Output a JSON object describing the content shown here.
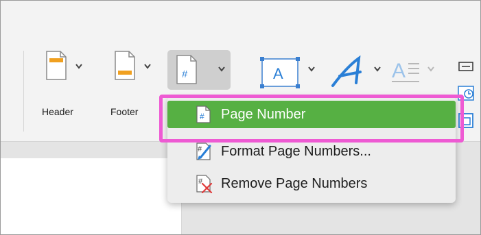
{
  "ribbon": {
    "header_label": "Header",
    "footer_label": "Footer",
    "page_number_icon_glyph": "#",
    "textbox_glyph": "A"
  },
  "menu": {
    "items": [
      {
        "label": "Page Number",
        "icon": "page-number-icon",
        "selected": true
      },
      {
        "label": "Format Page Numbers...",
        "icon": "format-page-numbers-icon",
        "selected": false
      },
      {
        "label": "Remove Page Numbers",
        "icon": "remove-page-numbers-icon",
        "selected": false
      }
    ]
  },
  "colors": {
    "selected_bg": "#56b043",
    "highlight_border": "#ee5ad3",
    "accent_blue": "#2a7fd6"
  }
}
